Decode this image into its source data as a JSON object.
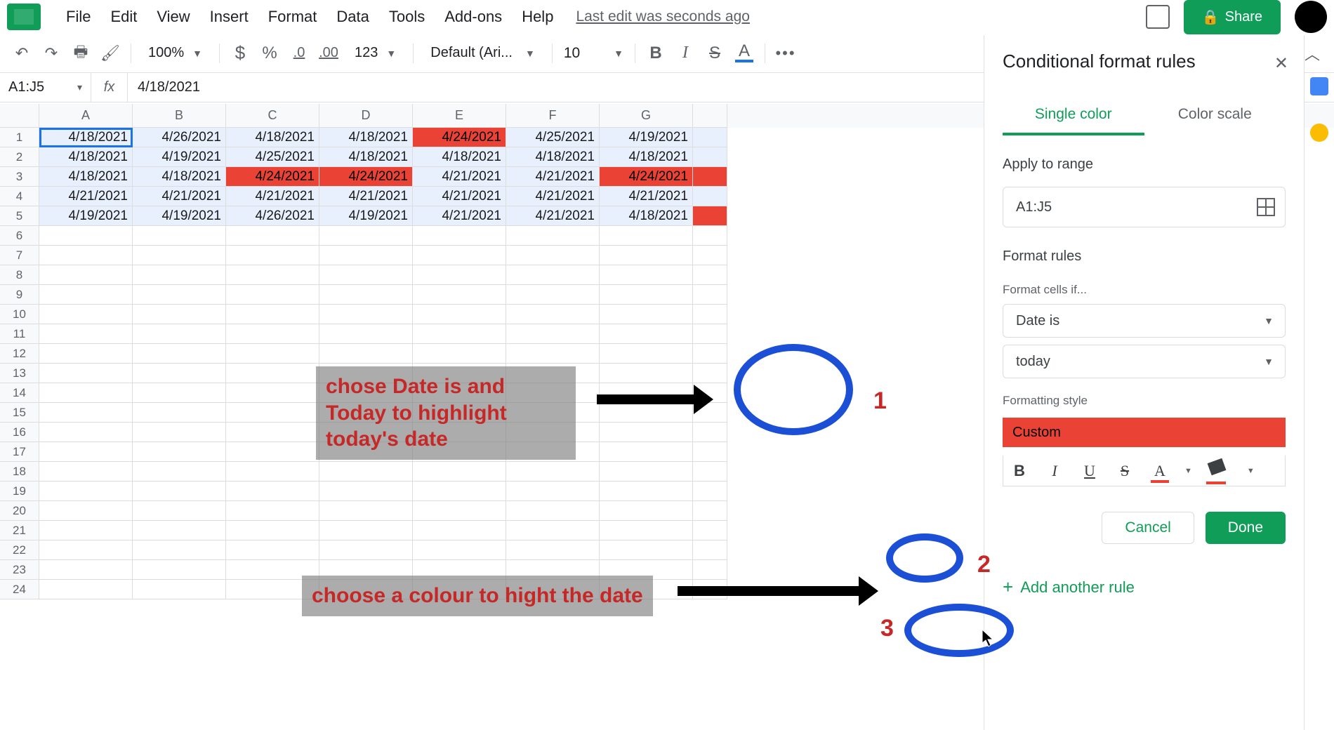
{
  "menus": [
    "File",
    "Edit",
    "View",
    "Insert",
    "Format",
    "Data",
    "Tools",
    "Add-ons",
    "Help"
  ],
  "last_edit": "Last edit was seconds ago",
  "share": "Share",
  "toolbar": {
    "zoom": "100%",
    "decimal0": ".0",
    "decimal00": ".00",
    "num123": "123",
    "font": "Default (Ari...",
    "font_size": "10"
  },
  "namebox": "A1:J5",
  "formula": "4/18/2021",
  "columns": [
    "A",
    "B",
    "C",
    "D",
    "E",
    "F",
    "G"
  ],
  "row_count_visible": 24,
  "sheet": {
    "rows": [
      [
        {
          "v": "4/18/2021"
        },
        {
          "v": "4/26/2021"
        },
        {
          "v": "4/18/2021"
        },
        {
          "v": "4/18/2021"
        },
        {
          "v": "4/24/2021",
          "hl": true
        },
        {
          "v": "4/25/2021"
        },
        {
          "v": "4/19/2021"
        }
      ],
      [
        {
          "v": "4/18/2021"
        },
        {
          "v": "4/19/2021"
        },
        {
          "v": "4/25/2021"
        },
        {
          "v": "4/18/2021"
        },
        {
          "v": "4/18/2021"
        },
        {
          "v": "4/18/2021"
        },
        {
          "v": "4/18/2021"
        }
      ],
      [
        {
          "v": "4/18/2021"
        },
        {
          "v": "4/18/2021"
        },
        {
          "v": "4/24/2021",
          "hl": true
        },
        {
          "v": "4/24/2021",
          "hl": true
        },
        {
          "v": "4/21/2021"
        },
        {
          "v": "4/21/2021"
        },
        {
          "v": "4/24/2021",
          "hl": true
        }
      ],
      [
        {
          "v": "4/21/2021"
        },
        {
          "v": "4/21/2021"
        },
        {
          "v": "4/21/2021"
        },
        {
          "v": "4/21/2021"
        },
        {
          "v": "4/21/2021"
        },
        {
          "v": "4/21/2021"
        },
        {
          "v": "4/21/2021"
        }
      ],
      [
        {
          "v": "4/19/2021"
        },
        {
          "v": "4/19/2021"
        },
        {
          "v": "4/26/2021"
        },
        {
          "v": "4/19/2021"
        },
        {
          "v": "4/21/2021"
        },
        {
          "v": "4/21/2021"
        },
        {
          "v": "4/18/2021"
        }
      ]
    ],
    "selection": {
      "r1": 1,
      "c1": 1,
      "r2": 5,
      "c2": 7,
      "active": {
        "r": 1,
        "c": 1
      }
    }
  },
  "panel": {
    "title": "Conditional format rules",
    "tab_single": "Single color",
    "tab_scale": "Color scale",
    "apply_label": "Apply to range",
    "range": "A1:J5",
    "rules_label": "Format rules",
    "cells_if": "Format cells if...",
    "cond1": "Date is",
    "cond2": "today",
    "style_label": "Formatting style",
    "style_name": "Custom",
    "cancel": "Cancel",
    "done": "Done",
    "add_rule": "Add another rule"
  },
  "annotations": {
    "box1": "chose Date is and Today to highlight today's date",
    "box2": "choose a colour to hight the date",
    "num1": "1",
    "num2": "2",
    "num3": "3"
  }
}
